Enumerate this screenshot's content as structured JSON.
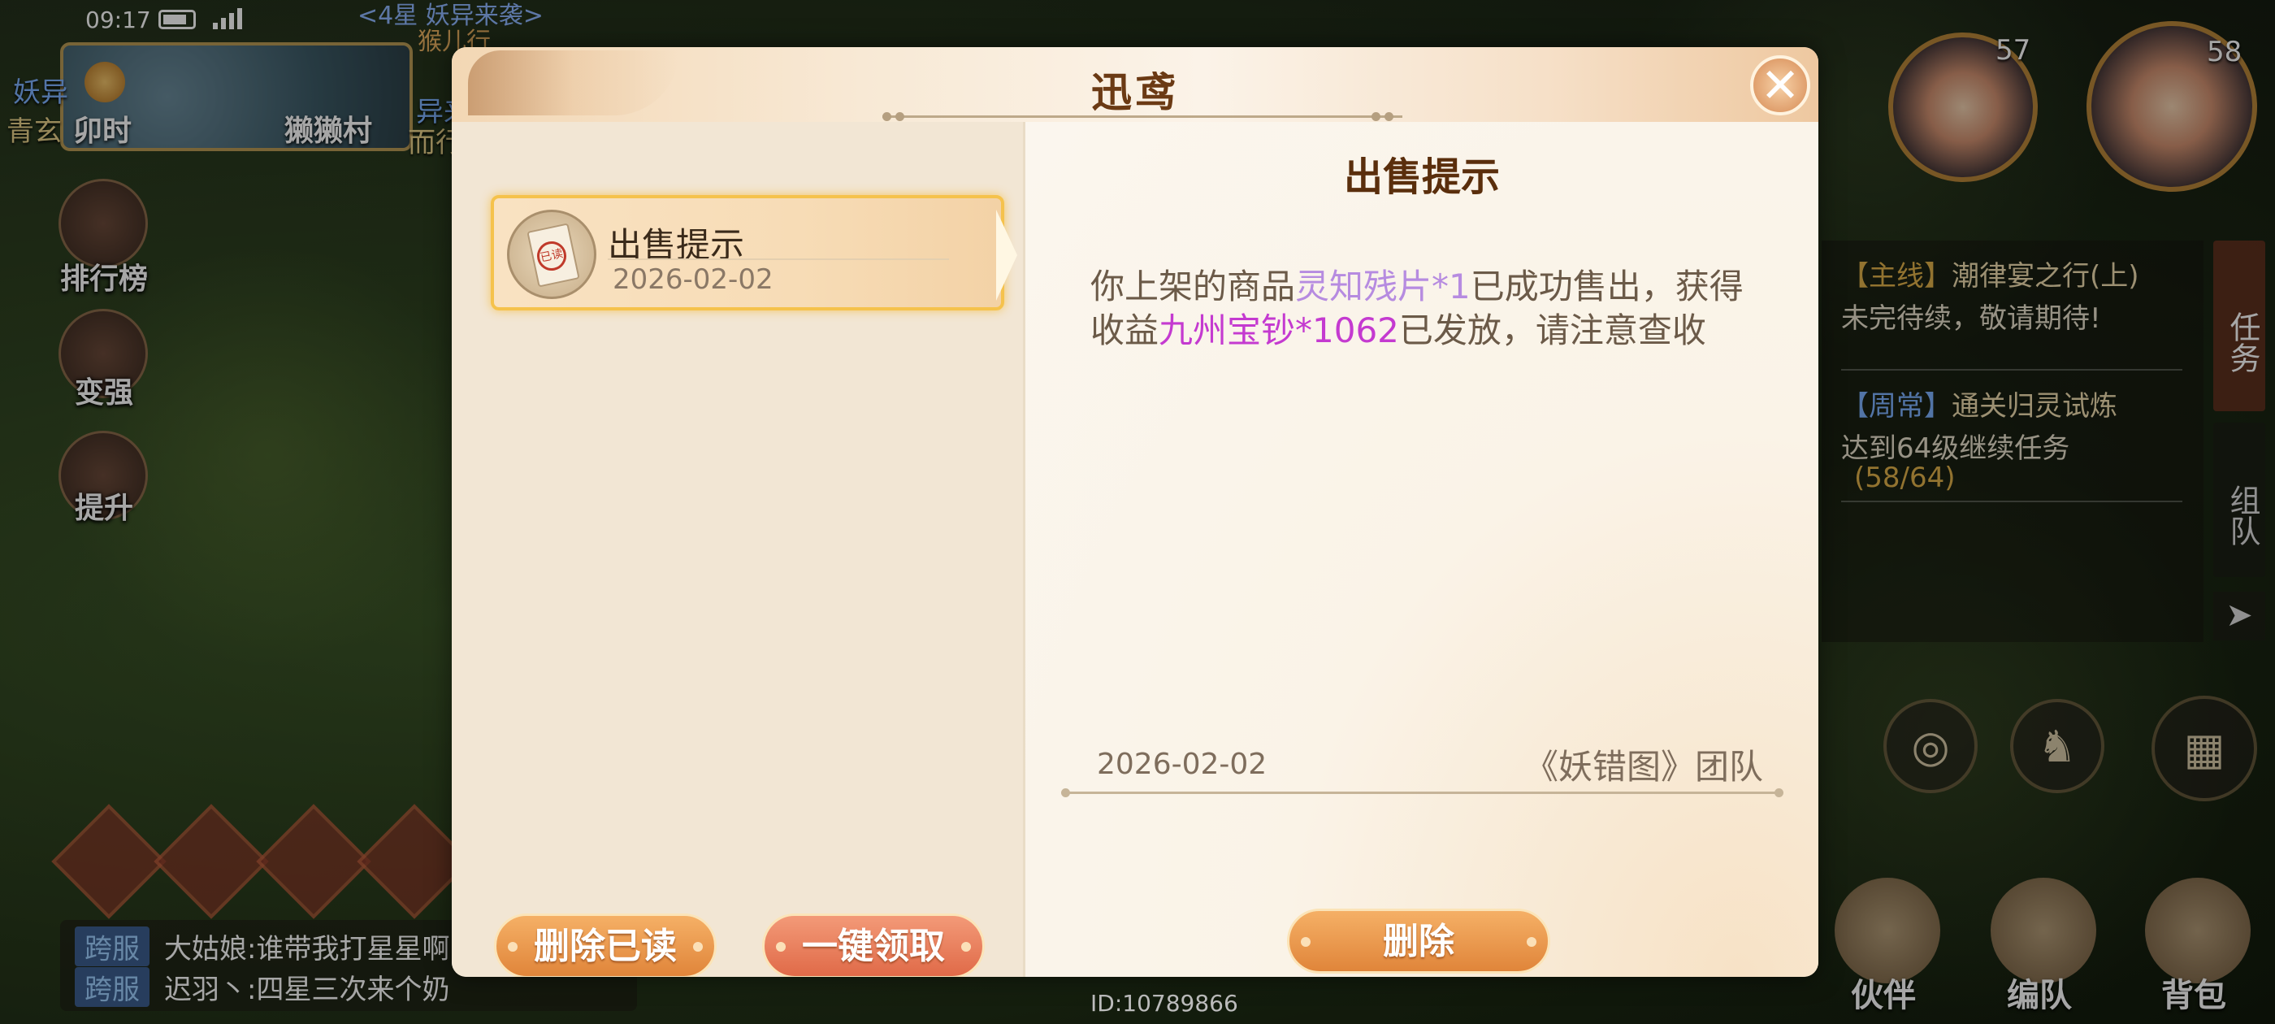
{
  "status_bar": {
    "time": "09:17"
  },
  "hud_left": {
    "minimap_time": "卯时",
    "minimap_location": "獭獭村",
    "top_notice": "<4星 妖异来袭>",
    "top_notice_sub": "猴儿行",
    "side_label_1": "妖异",
    "side_label_2": "青玄",
    "side_label_3": "异来",
    "side_label_4": "而行",
    "buttons": [
      {
        "label": "排行榜"
      },
      {
        "label": "变强"
      },
      {
        "label": "提升"
      }
    ]
  },
  "chat": {
    "rows": [
      {
        "tag": "跨服",
        "text": "大姑娘:谁带我打星星啊"
      },
      {
        "tag": "跨服",
        "text": "迟羽丶:四星三次来个奶"
      }
    ]
  },
  "hud_right": {
    "avatar_levels": [
      "57",
      "58"
    ],
    "tasks": [
      {
        "tag": "【主线】",
        "name": "潮律宴之行(上)",
        "desc": "未完待续，敬请期待!"
      },
      {
        "tag": "【周常】",
        "name": "通关归灵试炼",
        "desc": "达到64级继续任务",
        "progress": "(58/64)"
      }
    ],
    "tab_task": "任务",
    "tab_team": "组队",
    "bottom_labels": [
      "伙伴",
      "编队",
      "背包"
    ]
  },
  "player_id": "ID:10789866",
  "dialog": {
    "title": "迅鸢",
    "close_label": "✕",
    "mail_list": [
      {
        "title": "出售提示",
        "date": "2026-02-02",
        "stamp": "已读"
      }
    ],
    "delete_read_label": "删除已读",
    "claim_all_label": "一键领取",
    "detail": {
      "title": "出售提示",
      "body_1": "你上架的商品",
      "item": "灵知残片*1",
      "body_2": "已成功售出，获得收益",
      "reward": "九州宝钞*1062",
      "body_3": "已发放，请注意查收",
      "date": "2026-02-02",
      "signature": "《妖错图》团队",
      "delete_label": "删除"
    }
  }
}
